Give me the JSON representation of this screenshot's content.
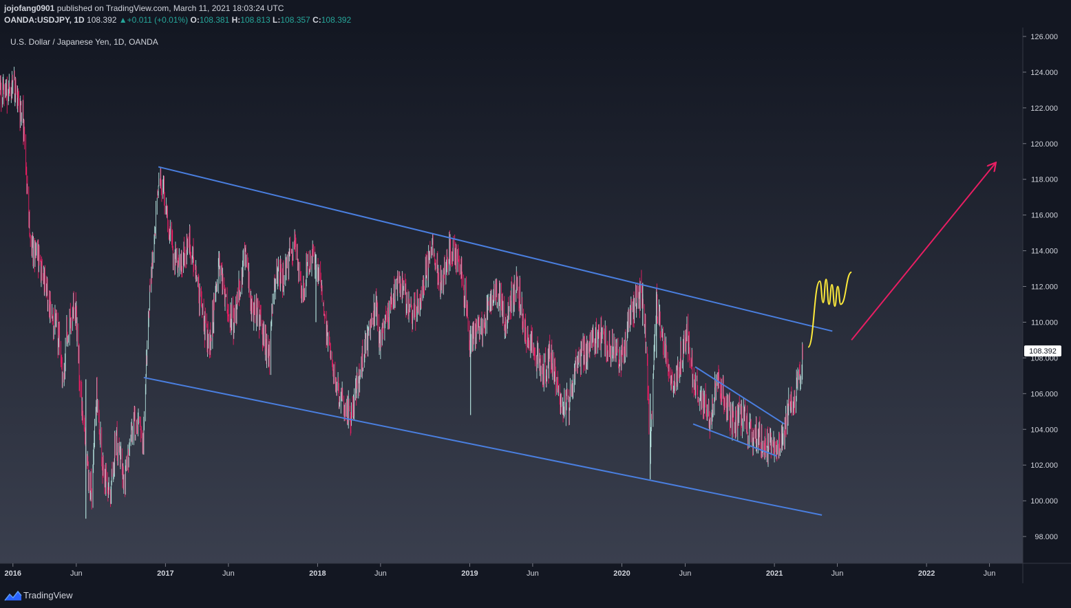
{
  "header": {
    "author": "jojofang0901",
    "published_text": "published on TradingView.com, March 11, 2021 18:03:24 UTC",
    "symbol": "OANDA:USDJPY, 1D",
    "last_price": "108.392",
    "change_arrow": "▲",
    "change": "+0.011 (+0.01%)",
    "open_label": "O:",
    "open_value": "108.381",
    "high_label": "H:",
    "high_value": "108.813",
    "low_label": "L:",
    "low_value": "108.357",
    "close_label": "C:",
    "close_value": "108.392"
  },
  "footer": {
    "brand": "TradingView",
    "logo_icon": "tradingview-logo-icon"
  },
  "colors": {
    "background_top": "#131722",
    "background_bottom": "#3a3f4e",
    "candle_up": "#b2dfdb",
    "candle_down": "#e91e63",
    "channel_lines": "#4a7fe0",
    "projection_squiggle": "#ffeb3b",
    "projection_arrow": "#e91e63",
    "price_badge_bg": "#ffffff",
    "axis_text": "#d1d4dc"
  },
  "chart_data": {
    "type": "candlestick",
    "title": "U.S. Dollar / Japanese Yen, 1D, OANDA",
    "xlabel": "",
    "ylabel": "",
    "ylim": [
      96.5,
      126.5
    ],
    "xlim": [
      "2015-12-01",
      "2022-08-20"
    ],
    "grid": false,
    "legend": "none",
    "y_ticks": [
      "98.000",
      "100.000",
      "102.000",
      "104.000",
      "106.000",
      "108.000",
      "110.000",
      "112.000",
      "114.000",
      "116.000",
      "118.000",
      "120.000",
      "122.000",
      "124.000",
      "126.000"
    ],
    "x_ticks": [
      {
        "label": "2016",
        "date": "2016-01-01",
        "bold": true
      },
      {
        "label": "Jun",
        "date": "2016-06-01",
        "bold": false
      },
      {
        "label": "2017",
        "date": "2017-01-01",
        "bold": true
      },
      {
        "label": "Jun",
        "date": "2017-06-01",
        "bold": false
      },
      {
        "label": "2018",
        "date": "2018-01-01",
        "bold": true
      },
      {
        "label": "Jun",
        "date": "2018-06-01",
        "bold": false
      },
      {
        "label": "2019",
        "date": "2019-01-01",
        "bold": true
      },
      {
        "label": "Jun",
        "date": "2019-06-01",
        "bold": false
      },
      {
        "label": "2020",
        "date": "2020-01-01",
        "bold": true
      },
      {
        "label": "Jun",
        "date": "2020-06-01",
        "bold": false
      },
      {
        "label": "2021",
        "date": "2021-01-01",
        "bold": true
      },
      {
        "label": "Jun",
        "date": "2021-06-01",
        "bold": false
      },
      {
        "label": "2022",
        "date": "2022-01-01",
        "bold": true
      },
      {
        "label": "Jun",
        "date": "2022-06-01",
        "bold": false
      }
    ],
    "last_price": 108.392,
    "last_price_label": "108.392",
    "close_path": [
      [
        "2015-12-01",
        122.8
      ],
      [
        "2016-01-05",
        123.2
      ],
      [
        "2016-01-25",
        121.3
      ],
      [
        "2016-02-05",
        117.5
      ],
      [
        "2016-02-15",
        114.0
      ],
      [
        "2016-03-01",
        113.8
      ],
      [
        "2016-03-20",
        111.8
      ],
      [
        "2016-04-05",
        110.2
      ],
      [
        "2016-04-20",
        109.0
      ],
      [
        "2016-05-01",
        107.0
      ],
      [
        "2016-05-10",
        109.5
      ],
      [
        "2016-05-30",
        110.8
      ],
      [
        "2016-06-10",
        106.5
      ],
      [
        "2016-06-24",
        102.5
      ],
      [
        "2016-07-08",
        100.5
      ],
      [
        "2016-07-20",
        106.0
      ],
      [
        "2016-08-05",
        101.5
      ],
      [
        "2016-08-20",
        100.3
      ],
      [
        "2016-09-05",
        103.5
      ],
      [
        "2016-09-25",
        100.8
      ],
      [
        "2016-10-10",
        104.0
      ],
      [
        "2016-10-30",
        104.5
      ],
      [
        "2016-11-09",
        103.0
      ],
      [
        "2016-11-20",
        110.5
      ],
      [
        "2016-12-05",
        114.0
      ],
      [
        "2016-12-15",
        118.2
      ],
      [
        "2016-12-30",
        116.8
      ],
      [
        "2017-01-15",
        114.5
      ],
      [
        "2017-02-01",
        113.0
      ],
      [
        "2017-03-01",
        114.5
      ],
      [
        "2017-03-25",
        111.0
      ],
      [
        "2017-04-17",
        108.5
      ],
      [
        "2017-05-10",
        113.5
      ],
      [
        "2017-05-25",
        111.0
      ],
      [
        "2017-06-15",
        109.8
      ],
      [
        "2017-07-10",
        114.0
      ],
      [
        "2017-07-25",
        111.0
      ],
      [
        "2017-08-15",
        110.0
      ],
      [
        "2017-09-08",
        108.0
      ],
      [
        "2017-09-20",
        112.5
      ],
      [
        "2017-10-10",
        112.5
      ],
      [
        "2017-11-06",
        114.5
      ],
      [
        "2017-11-25",
        111.5
      ],
      [
        "2017-12-12",
        113.5
      ],
      [
        "2018-01-05",
        113.0
      ],
      [
        "2018-01-25",
        109.0
      ],
      [
        "2018-02-15",
        106.5
      ],
      [
        "2018-03-05",
        105.5
      ],
      [
        "2018-03-23",
        104.8
      ],
      [
        "2018-04-10",
        107.0
      ],
      [
        "2018-05-21",
        111.0
      ],
      [
        "2018-05-30",
        108.8
      ],
      [
        "2018-06-20",
        110.5
      ],
      [
        "2018-07-18",
        112.5
      ],
      [
        "2018-08-10",
        110.5
      ],
      [
        "2018-09-05",
        111.0
      ],
      [
        "2018-10-04",
        114.5
      ],
      [
        "2018-10-25",
        111.8
      ],
      [
        "2018-11-12",
        114.0
      ],
      [
        "2018-12-10",
        113.2
      ],
      [
        "2018-12-25",
        110.5
      ],
      [
        "2019-01-03",
        108.5
      ],
      [
        "2019-01-20",
        109.5
      ],
      [
        "2019-02-20",
        110.8
      ],
      [
        "2019-03-05",
        111.8
      ],
      [
        "2019-03-25",
        110.0
      ],
      [
        "2019-04-24",
        112.2
      ],
      [
        "2019-05-15",
        109.5
      ],
      [
        "2019-06-05",
        108.2
      ],
      [
        "2019-06-25",
        107.3
      ],
      [
        "2019-07-15",
        108.0
      ],
      [
        "2019-08-05",
        106.0
      ],
      [
        "2019-08-26",
        105.2
      ],
      [
        "2019-09-15",
        107.8
      ],
      [
        "2019-10-15",
        108.7
      ],
      [
        "2019-11-07",
        109.4
      ],
      [
        "2019-12-05",
        108.6
      ],
      [
        "2020-01-05",
        108.0
      ],
      [
        "2020-01-17",
        110.2
      ],
      [
        "2020-02-20",
        111.8
      ],
      [
        "2020-03-01",
        108.0
      ],
      [
        "2020-03-09",
        102.5
      ],
      [
        "2020-03-24",
        111.0
      ],
      [
        "2020-04-10",
        108.5
      ],
      [
        "2020-05-05",
        106.5
      ],
      [
        "2020-06-05",
        109.5
      ],
      [
        "2020-06-20",
        106.8
      ],
      [
        "2020-07-31",
        104.5
      ],
      [
        "2020-08-15",
        106.5
      ],
      [
        "2020-09-01",
        105.8
      ],
      [
        "2020-09-21",
        104.5
      ],
      [
        "2020-10-20",
        105.0
      ],
      [
        "2020-11-06",
        103.4
      ],
      [
        "2020-11-20",
        103.8
      ],
      [
        "2020-12-17",
        103.0
      ],
      [
        "2021-01-06",
        102.9
      ],
      [
        "2021-01-25",
        103.8
      ],
      [
        "2021-02-05",
        105.5
      ],
      [
        "2021-02-18",
        105.5
      ],
      [
        "2021-03-01",
        106.8
      ],
      [
        "2021-03-11",
        108.392
      ]
    ],
    "spikes": [
      {
        "date": "2016-06-24",
        "low": 99.0,
        "high": 106.8
      },
      {
        "date": "2017-12-28",
        "high": 113.8,
        "low": 110.0
      },
      {
        "date": "2019-01-03",
        "low": 104.8,
        "high": 109.8
      },
      {
        "date": "2020-03-09",
        "low": 101.2,
        "high": 106.0
      },
      {
        "date": "2020-02-20",
        "high": 112.2,
        "low": 109.8
      },
      {
        "date": "2020-03-24",
        "high": 111.7,
        "low": 108.0
      }
    ],
    "trendlines": [
      {
        "name": "channel-upper",
        "from": {
          "date": "2016-12-15",
          "price": 118.7
        },
        "to": {
          "date": "2021-05-20",
          "price": 109.5
        },
        "color": "#4a7fe0"
      },
      {
        "name": "channel-lower",
        "from": {
          "date": "2016-11-10",
          "price": 106.9
        },
        "to": {
          "date": "2021-04-25",
          "price": 99.2
        },
        "color": "#4a7fe0"
      },
      {
        "name": "wedge-upper",
        "from": {
          "date": "2020-06-25",
          "price": 107.5
        },
        "to": {
          "date": "2021-01-25",
          "price": 104.3
        },
        "color": "#4a7fe0"
      },
      {
        "name": "wedge-lower",
        "from": {
          "date": "2020-06-20",
          "price": 104.3
        },
        "to": {
          "date": "2021-01-07",
          "price": 102.5
        },
        "color": "#4a7fe0"
      }
    ],
    "projection_squiggle": [
      [
        "2021-03-23",
        108.6
      ],
      [
        "2021-04-20",
        112.3
      ],
      [
        "2021-04-28",
        111.1
      ],
      [
        "2021-05-05",
        112.4
      ],
      [
        "2021-05-12",
        111.0
      ],
      [
        "2021-05-19",
        112.1
      ],
      [
        "2021-05-26",
        110.9
      ],
      [
        "2021-06-02",
        112.0
      ],
      [
        "2021-06-09",
        111.0
      ],
      [
        "2021-07-05",
        112.8
      ]
    ],
    "projection_arrow": {
      "from": {
        "date": "2021-07-05",
        "price": 109.0
      },
      "to": {
        "date": "2022-06-15",
        "price": 118.9
      }
    }
  }
}
